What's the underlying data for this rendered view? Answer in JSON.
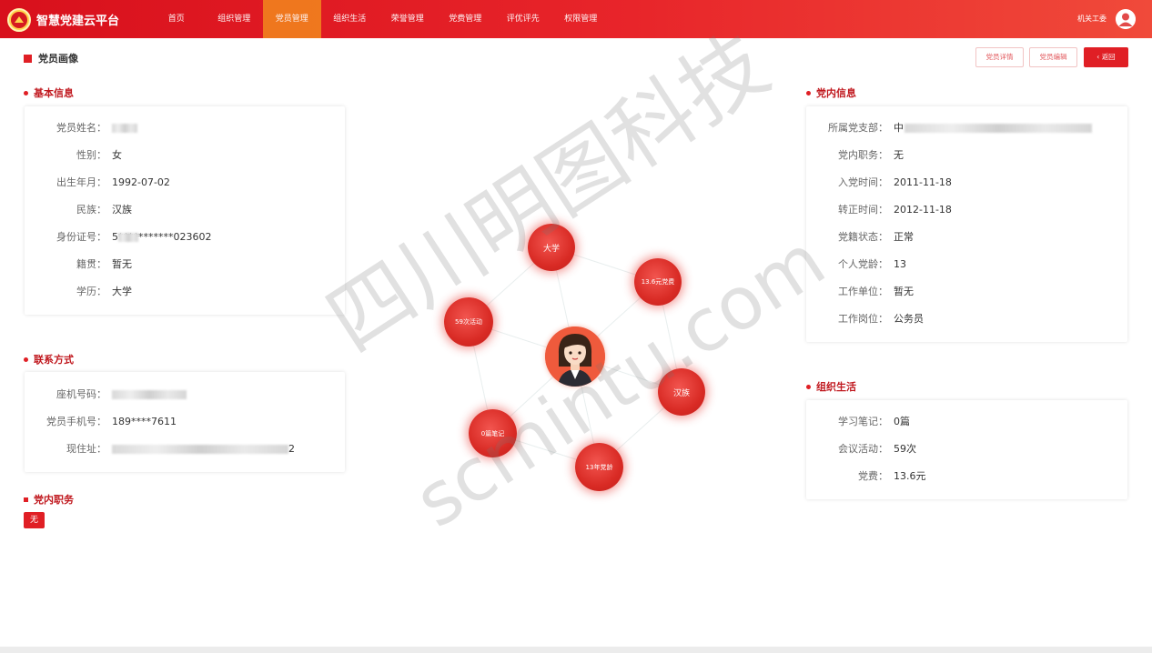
{
  "app": {
    "title": "智慧党建云平台",
    "user": "机关工委"
  },
  "nav": [
    "首页",
    "组织管理",
    "党员管理",
    "组织生活",
    "荣誉管理",
    "党费管理",
    "评优评先",
    "权限管理"
  ],
  "page": {
    "title": "党员画像",
    "buttons": {
      "detail": "党员详情",
      "edit": "党员编辑",
      "back": "返回"
    }
  },
  "basic": {
    "title": "基本信息",
    "rows": [
      {
        "k": "党员姓名：",
        "v": ""
      },
      {
        "k": "性别：",
        "v": "女"
      },
      {
        "k": "出生年月：",
        "v": "1992-07-02"
      },
      {
        "k": "民族：",
        "v": "汉族"
      },
      {
        "k": "身份证号：",
        "v": "5***********023602"
      },
      {
        "k": "籍贯：",
        "v": "暂无"
      },
      {
        "k": "学历：",
        "v": "大学"
      }
    ]
  },
  "contact": {
    "title": "联系方式",
    "rows": [
      {
        "k": "座机号码：",
        "v": ""
      },
      {
        "k": "党员手机号：",
        "v": "189****7611"
      },
      {
        "k": "现住址：",
        "v": "2"
      }
    ]
  },
  "duty": {
    "title": "党内职务",
    "tag": "无"
  },
  "party": {
    "title": "党内信息",
    "rows": [
      {
        "k": "所属党支部：",
        "v": "中"
      },
      {
        "k": "党内职务：",
        "v": "无"
      },
      {
        "k": "入党时间：",
        "v": "2011-11-18"
      },
      {
        "k": "转正时间：",
        "v": "2012-11-18"
      },
      {
        "k": "党籍状态：",
        "v": "正常"
      },
      {
        "k": "个人党龄：",
        "v": "13"
      },
      {
        "k": "工作单位：",
        "v": "暂无"
      },
      {
        "k": "工作岗位：",
        "v": "公务员"
      }
    ]
  },
  "org_life": {
    "title": "组织生活",
    "rows": [
      {
        "k": "学习笔记：",
        "v": "0篇"
      },
      {
        "k": "会议活动：",
        "v": "59次"
      },
      {
        "k": "党费：",
        "v": "13.6元"
      }
    ]
  },
  "bubbles": [
    "大学",
    "13.6元党费",
    "59次活动",
    "汉族",
    "0篇笔记",
    "13年党龄"
  ],
  "watermark": {
    "cn": "四川明图科技",
    "en": "scmintu.com"
  }
}
